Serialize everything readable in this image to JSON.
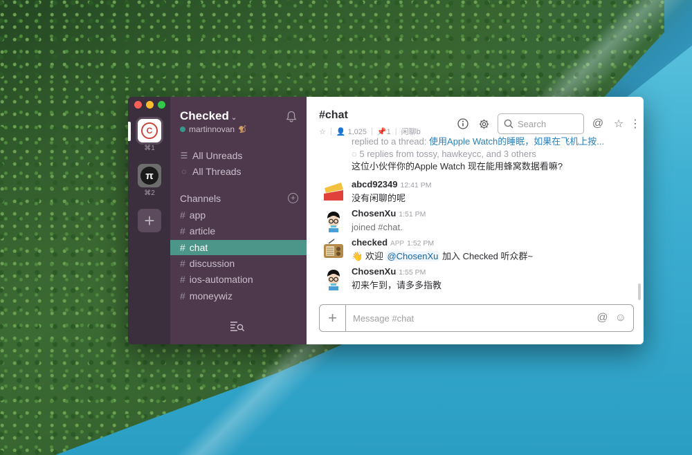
{
  "team_switcher": {
    "teams": [
      {
        "logo_text": "C",
        "shortcut": "⌘1",
        "active": true
      },
      {
        "logo_text": "π",
        "shortcut": "⌘2",
        "active": false
      }
    ],
    "add_label": "+"
  },
  "sidebar": {
    "workspace": "Checked",
    "user": "martinnovan",
    "user_emoji": "🐒",
    "nav": [
      {
        "label": "All Unreads",
        "icon": "all-unreads-icon"
      },
      {
        "label": "All Threads",
        "icon": "threads-icon"
      }
    ],
    "channels_header": "Channels",
    "channels": [
      {
        "name": "app",
        "active": false
      },
      {
        "name": "article",
        "active": false
      },
      {
        "name": "chat",
        "active": true
      },
      {
        "name": "discussion",
        "active": false
      },
      {
        "name": "ios-automation",
        "active": false
      },
      {
        "name": "moneywiz",
        "active": false
      }
    ],
    "hash": "#"
  },
  "header": {
    "title": "#chat",
    "members": "1,025",
    "pins": "1",
    "topic": "闲聊b",
    "search_placeholder": "Search"
  },
  "thread_reply": {
    "replied_prefix": "replied to a thread:",
    "replied_link": "使用Apple Watch的睡眠，如果在飞机上按...",
    "replies": "5 replies from tossy, hawkeycc, and 3 others",
    "text": "这位小伙伴你的Apple Watch 现在能用蜂窝数据看嘛?"
  },
  "messages": [
    {
      "author": "abcd92349",
      "time": "12:41 PM",
      "text": "没有闲聊的呢",
      "app": ""
    },
    {
      "author": "ChosenXu",
      "time": "1:51 PM",
      "text": "joined #chat.",
      "app": ""
    },
    {
      "author": "checked",
      "time": "1:52 PM",
      "app": "APP",
      "wave": "👋",
      "pre": "欢迎",
      "mention": "@ChosenXu",
      "post": "加入 Checked 听众群~"
    },
    {
      "author": "ChosenXu",
      "time": "1:55 PM",
      "text": "初来乍到，请多多指教",
      "app": ""
    }
  ],
  "composer": {
    "placeholder": "Message #chat"
  },
  "colors": {
    "sidebar": "#4d394b",
    "team_bar": "#3b2e3d",
    "active_channel": "#4c9689",
    "link": "#2a80b9"
  }
}
